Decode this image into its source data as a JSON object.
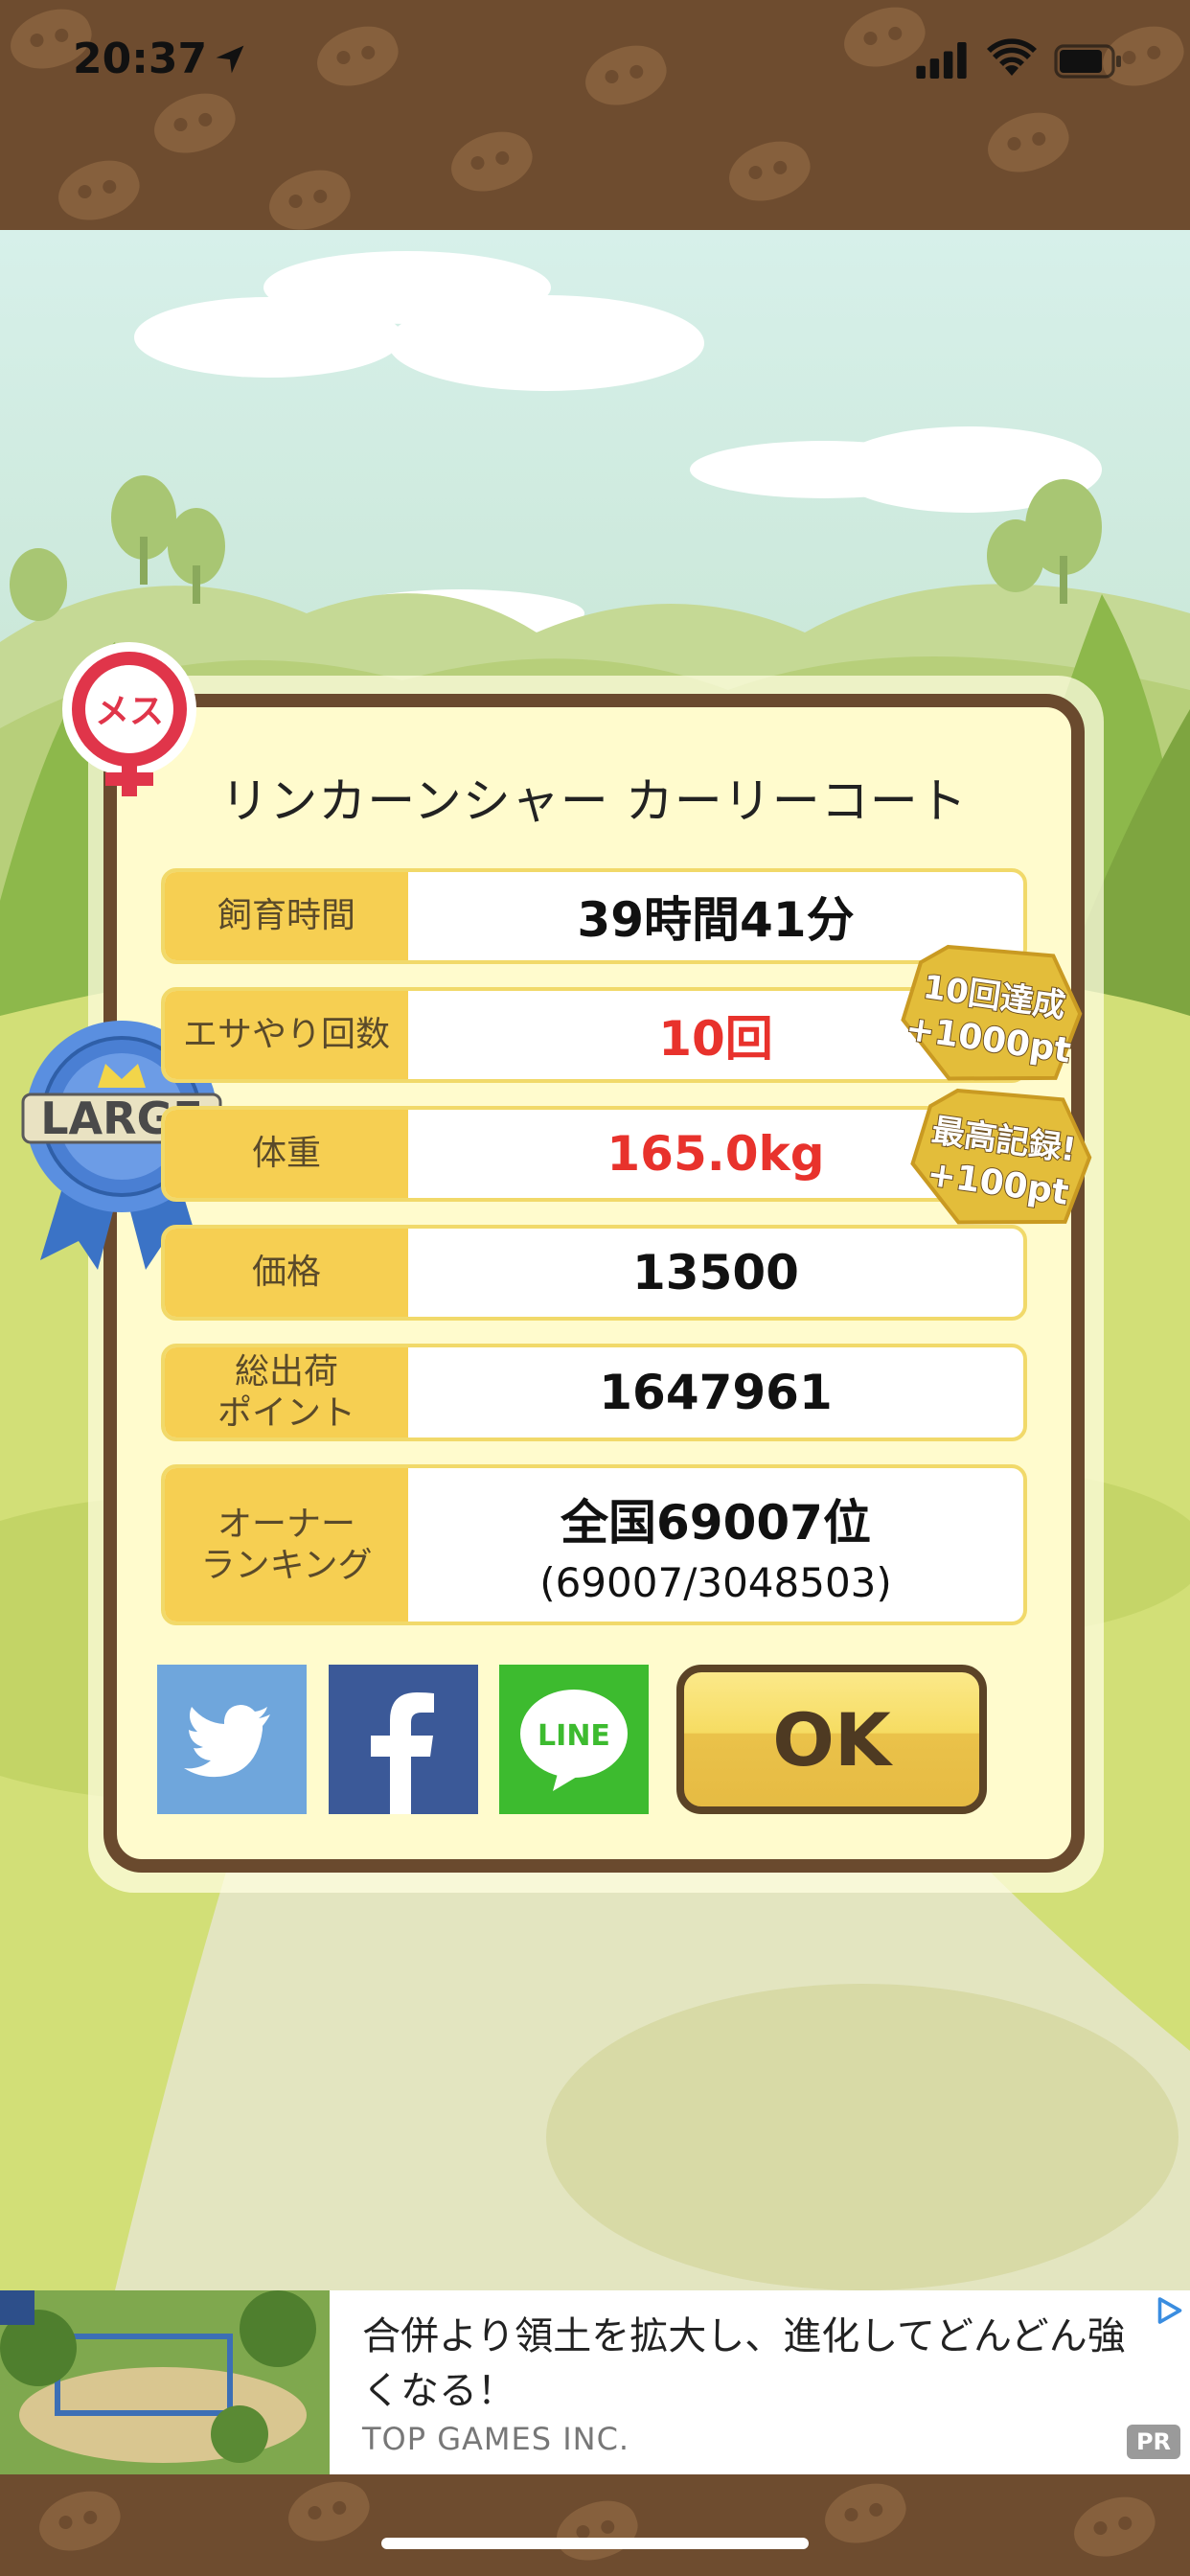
{
  "status_bar": {
    "time": "20:37"
  },
  "result": {
    "gender_badge": "メス",
    "size_badge": "LARGE",
    "name": "リンカーンシャー カーリーコート",
    "rows": [
      {
        "label": "飼育時間",
        "value": "39時間41分",
        "highlight": false
      },
      {
        "label": "エサやり回数",
        "value": "10回",
        "highlight": true
      },
      {
        "label": "体重",
        "value": "165.0kg",
        "highlight": true
      },
      {
        "label": "価格",
        "value": "13500",
        "highlight": false
      },
      {
        "label": "総出荷\nポイント",
        "value": "1647961",
        "highlight": false
      },
      {
        "label": "オーナー\nランキング",
        "value": "全国69007位",
        "sub_value": "(69007/3048503)",
        "highlight": false
      }
    ],
    "bonus_badges": [
      {
        "line1": "10回達成",
        "line2": "+1000pt"
      },
      {
        "line1": "最高記録!",
        "line2": "+100pt"
      }
    ],
    "share_buttons": [
      {
        "name": "twitter",
        "icon": "twitter-bird-icon",
        "color": "#6fa6dc"
      },
      {
        "name": "facebook",
        "icon": "facebook-f-icon",
        "color": "#3b5998"
      },
      {
        "name": "line",
        "icon": "line-icon",
        "label": "LINE",
        "color": "#3dbb2f"
      }
    ],
    "ok_label": "OK"
  },
  "ad": {
    "text": "合併より領土を拡大し、進化してどんどん強くなる！",
    "company": "TOP GAMES INC.",
    "pr_label": "PR"
  },
  "colors": {
    "frame_brown": "#6a4a2e",
    "label_yellow": "#f6cf52",
    "highlight_red": "#e8322c",
    "panel_cream": "#fffbcd"
  }
}
